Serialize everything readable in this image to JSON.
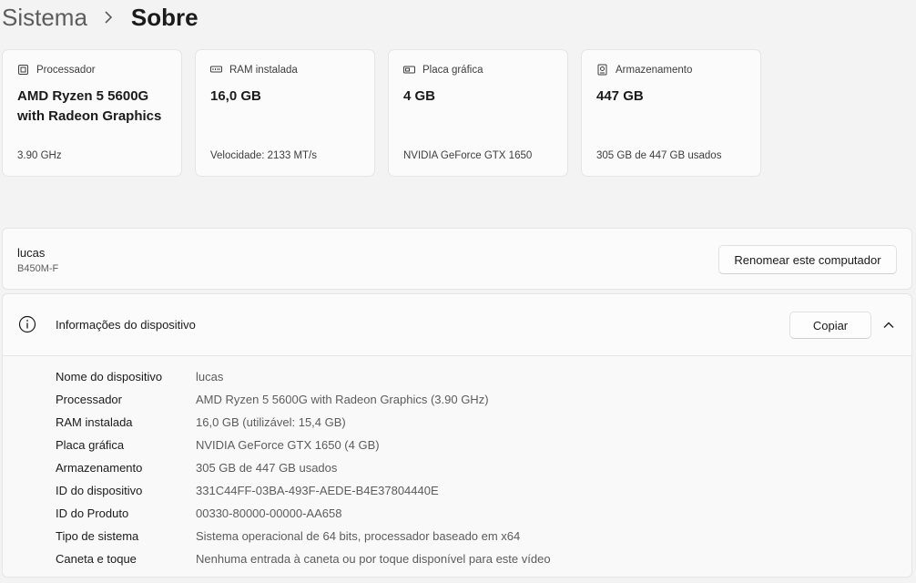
{
  "breadcrumb": {
    "parent": "Sistema",
    "current": "Sobre"
  },
  "spec_cards": [
    {
      "label": "Processador",
      "icon": "processor-chip-icon",
      "value": "AMD Ryzen 5 5600G with Radeon Graphics",
      "sub": "3.90 GHz"
    },
    {
      "label": "RAM instalada",
      "icon": "memory-ram-icon",
      "value": "16,0 GB",
      "sub": "Velocidade: 2133 MT/s"
    },
    {
      "label": "Placa gráfica",
      "icon": "graphics-card-icon",
      "value": "4 GB",
      "sub": "NVIDIA GeForce GTX 1650"
    },
    {
      "label": "Armazenamento",
      "icon": "storage-drive-icon",
      "value": "447 GB",
      "sub": "305 GB de 447 GB usados"
    }
  ],
  "computer": {
    "name": "lucas",
    "model": "B450M-F",
    "rename_label": "Renomear este computador"
  },
  "device_info": {
    "title": "Informações do dispositivo",
    "copy_label": "Copiar",
    "rows": [
      {
        "label": "Nome do dispositivo",
        "value": "lucas"
      },
      {
        "label": "Processador",
        "value": "AMD Ryzen 5 5600G with Radeon Graphics (3.90 GHz)"
      },
      {
        "label": "RAM instalada",
        "value": "16,0 GB (utilizável: 15,4 GB)"
      },
      {
        "label": "Placa gráfica",
        "value": "NVIDIA GeForce GTX 1650 (4 GB)"
      },
      {
        "label": "Armazenamento",
        "value": "305 GB de 447 GB usados"
      },
      {
        "label": "ID do dispositivo",
        "value": "331C44FF-03BA-493F-AEDE-B4E37804440E"
      },
      {
        "label": "ID do Produto",
        "value": "00330-80000-00000-AA658"
      },
      {
        "label": "Tipo de sistema",
        "value": "Sistema operacional de 64 bits, processador baseado em x64"
      },
      {
        "label": "Caneta e toque",
        "value": "Nenhuma entrada à caneta ou por toque disponível para este vídeo"
      }
    ]
  }
}
